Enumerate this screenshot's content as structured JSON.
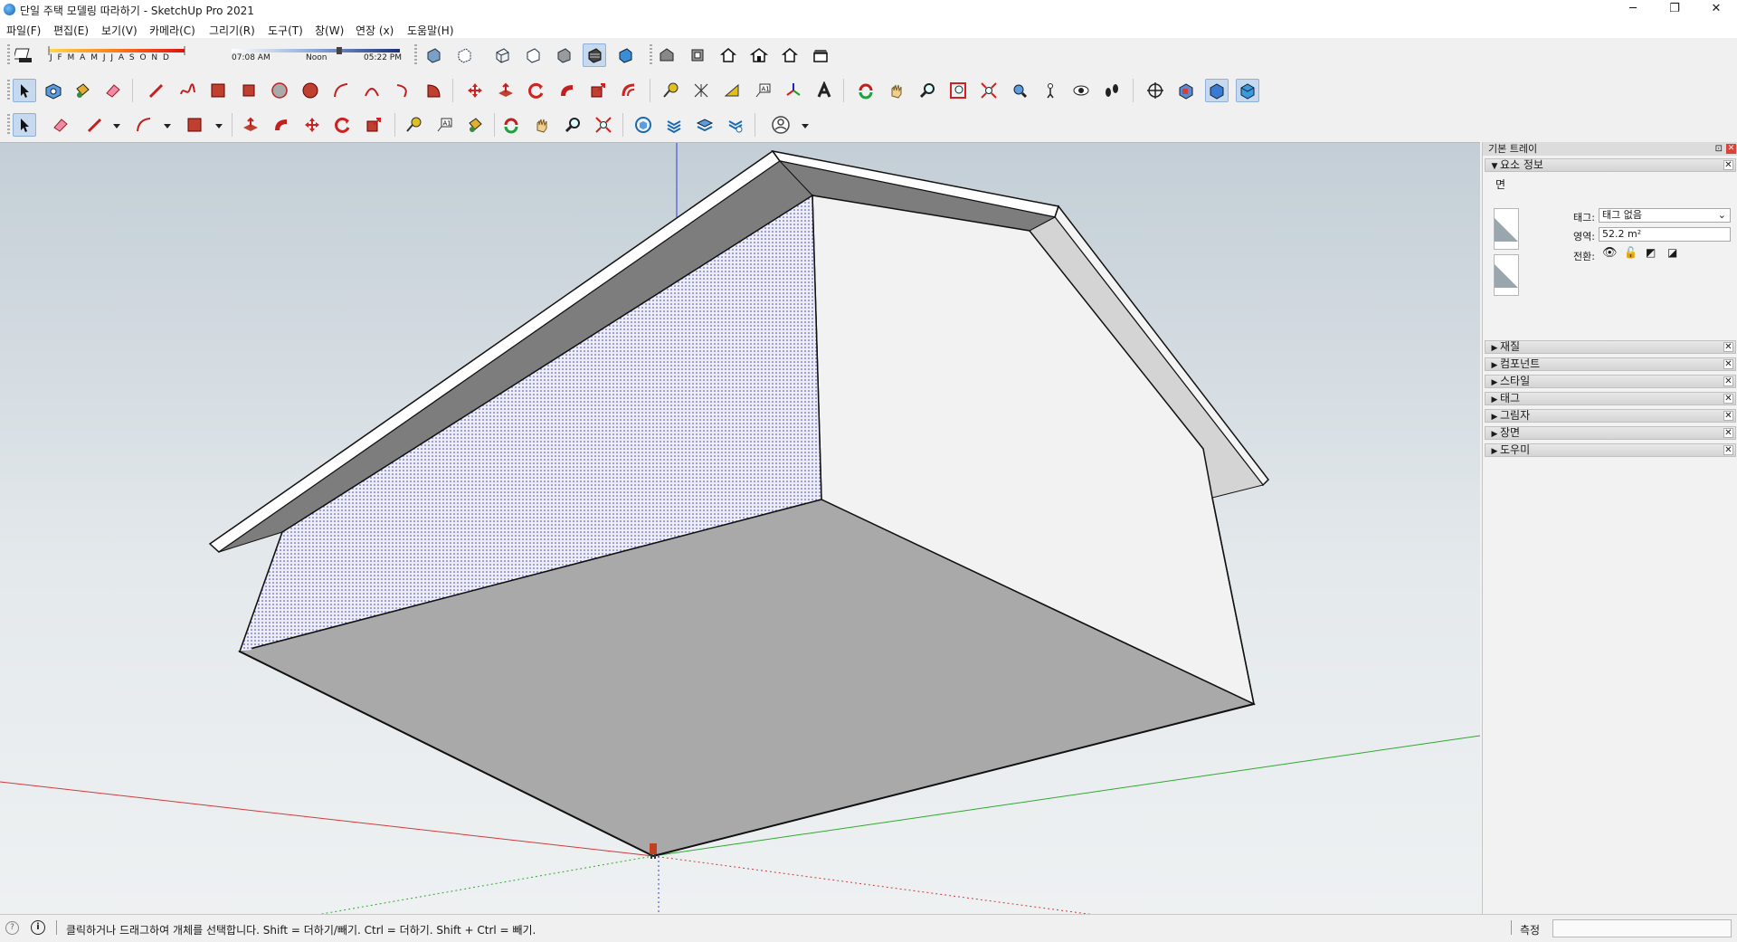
{
  "window": {
    "title": "단일 주택 모델링 따라하기 - SketchUp Pro 2021",
    "minimize": "─",
    "restore": "❐",
    "close": "✕"
  },
  "menu": [
    {
      "label": "파일(F)"
    },
    {
      "label": "편집(E)"
    },
    {
      "label": "보기(V)"
    },
    {
      "label": "카메라(C)"
    },
    {
      "label": "그리기(R)"
    },
    {
      "label": "도구(T)"
    },
    {
      "label": "창(W)"
    },
    {
      "label": "연장 (x)"
    },
    {
      "label": "도움말(H)"
    }
  ],
  "shadow_settings": {
    "months": "J F M A M J J A S O N D",
    "time_start": "07:08 AM",
    "time_mid": "Noon",
    "time_end": "05:22 PM"
  },
  "tray": {
    "title": "기본 트레이",
    "entity_info": {
      "header": "요소 정보",
      "entity_type": "면",
      "tag_label": "태그:",
      "tag_value": "태그 없음",
      "area_label": "영역:",
      "area_value": "52.2 m²",
      "toggle_label": "전환:"
    },
    "panels": [
      {
        "label": "재질"
      },
      {
        "label": "컴포넌트"
      },
      {
        "label": "스타일"
      },
      {
        "label": "태그"
      },
      {
        "label": "그림자"
      },
      {
        "label": "장면"
      },
      {
        "label": "도우미"
      }
    ]
  },
  "status": {
    "message": "클릭하거나 드래그하여 개체를 선택합니다. Shift = 더하기/빼기. Ctrl = 더하기. Shift + Ctrl = 빼기.",
    "measure_label": "측정",
    "measure_value": ""
  },
  "colors": {
    "red_axis": "#d23a3a",
    "green_axis": "#2fa82f",
    "blue_axis": "#3a3ad2",
    "selected_face": "#3d3dc4",
    "accent": "#c6d9ef"
  }
}
